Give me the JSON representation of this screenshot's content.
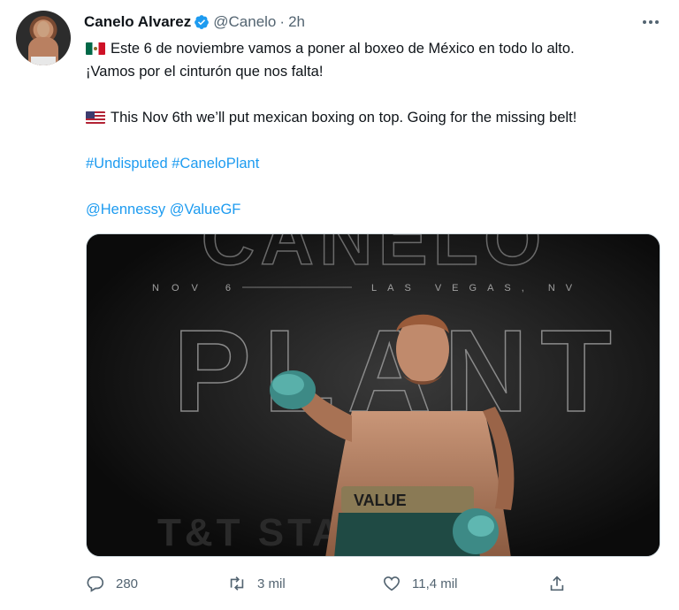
{
  "author": {
    "name": "Canelo Alvarez",
    "handle": "@Canelo",
    "separator": "·",
    "time": "2h"
  },
  "tweet": {
    "line_es_1": "Este 6 de noviembre vamos a poner al boxeo de México en todo lo alto.",
    "line_es_2": "¡Vamos por el cinturón que nos falta!",
    "line_en": "This Nov 6th we’ll put mexican boxing on top. Going for the missing belt!",
    "hashtag_1": "#Undisputed",
    "hashtag_2": "#CaneloPlant",
    "mention_1": "@Hennessy",
    "mention_2": "@ValueGF"
  },
  "media": {
    "poster_top_word": "CANELO",
    "poster_main_word": "PLANT",
    "date": "NOV 6",
    "location": "LAS VEGAS, NV",
    "trunks_text": "VALUE",
    "banner_text": "T&T STADIUM"
  },
  "actions": {
    "replies": "280",
    "retweets": "3 mil",
    "likes": "11,4 mil"
  },
  "icons": {
    "verified": "verified-badge-icon",
    "more": "more-options-icon",
    "reply": "reply-icon",
    "retweet": "retweet-icon",
    "like": "like-icon",
    "share": "share-icon",
    "flag_mx": "mexico-flag-icon",
    "flag_us": "usa-flag-icon"
  },
  "colors": {
    "link": "#1d9bf0",
    "verified": "#1d9bf0",
    "secondary_text": "#536471",
    "primary_text": "#0f1419"
  }
}
